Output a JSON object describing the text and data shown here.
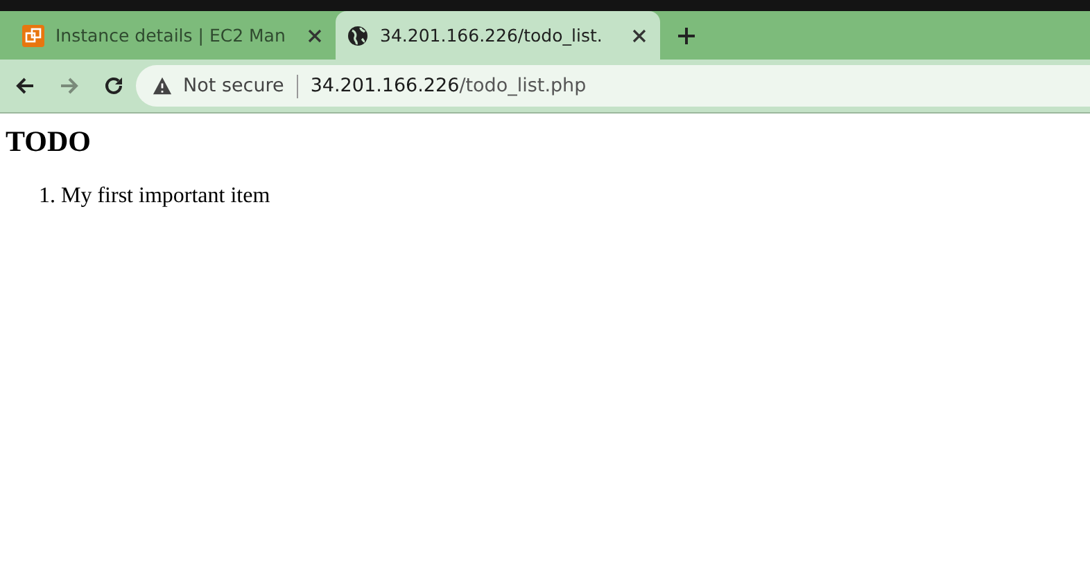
{
  "tabs": [
    {
      "title": "Instance details | EC2 Man",
      "kind": "app",
      "selected": false
    },
    {
      "title": "34.201.166.226/todo_list.",
      "kind": "web",
      "selected": true
    }
  ],
  "address_bar": {
    "security": "Not secure",
    "host": "34.201.166.226",
    "path": "/todo_list.php"
  },
  "page": {
    "heading": "TODO",
    "items": [
      {
        "number": "1.",
        "text": "My first important item"
      }
    ]
  }
}
